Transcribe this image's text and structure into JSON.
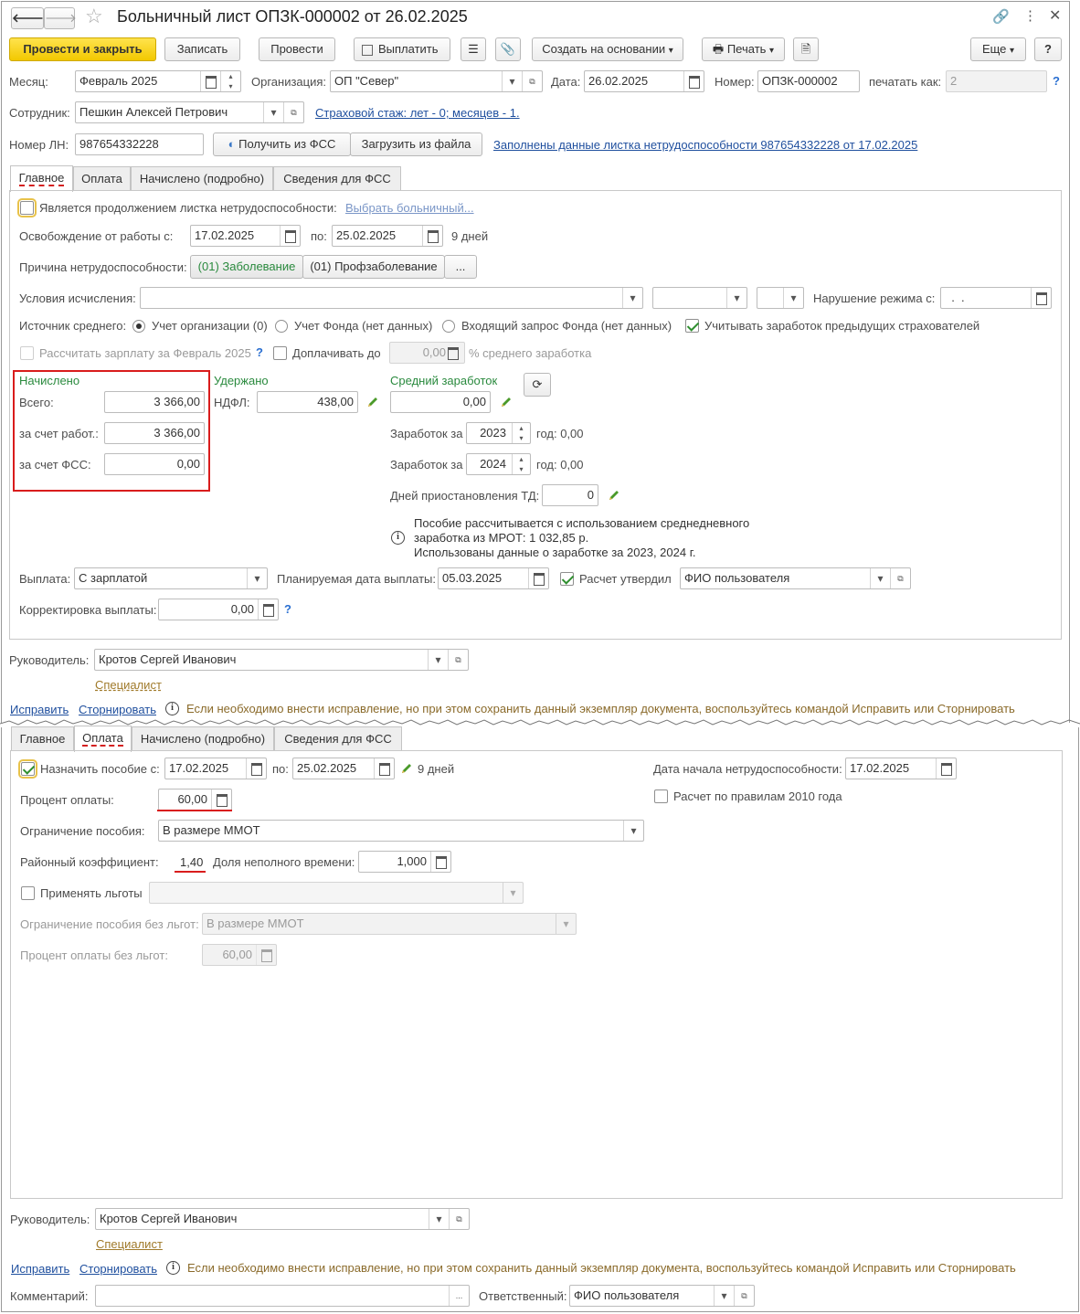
{
  "window": {
    "title": "Больничный лист ОПЗК-000002 от 26.02.2025"
  },
  "toolbar": {
    "post_close": "Провести и закрыть",
    "save": "Записать",
    "post": "Провести",
    "pay": "Выплатить",
    "create_based": "Создать на основании",
    "print": "Печать",
    "more": "Еще",
    "help": "?"
  },
  "header": {
    "month_label": "Месяц:",
    "month_value": "Февраль 2025",
    "org_label": "Организация:",
    "org_value": "ОП \"Север\"",
    "date_label": "Дата:",
    "date_value": "26.02.2025",
    "number_label": "Номер:",
    "number_value": "ОПЗК-000002",
    "print_as_label": "печатать как:",
    "print_as_value": "2",
    "employee_label": "Сотрудник:",
    "employee_value": "Пешкин Алексей Петрович",
    "insurance_link": "Страховой стаж: лет - 0; месяцев - 1.",
    "ln_label": "Номер ЛН:",
    "ln_value": "987654332228",
    "get_fss": "Получить из ФСС",
    "load_file": "Загрузить из файла",
    "filled_link": "Заполнены данные листка нетрудоспособности 987654332228 от 17.02.2025"
  },
  "tabs": [
    "Главное",
    "Оплата",
    "Начислено (подробно)",
    "Сведения для ФСС"
  ],
  "main": {
    "continuation": "Является продолжением листка нетрудоспособности:",
    "choose_link": "Выбрать больничный...",
    "release_label": "Освобождение от работы с:",
    "release_from": "17.02.2025",
    "to_label": "по:",
    "release_to": "25.02.2025",
    "days": "9 дней",
    "reason_label": "Причина нетрудоспособности:",
    "reason1": "(01) Заболевание",
    "reason2": "(01) Профзаболевание",
    "reason_more": "...",
    "conditions_label": "Условия исчисления:",
    "violation_label": "Нарушение режима с:",
    "violation_value": "  .  .",
    "source_label": "Источник среднего:",
    "src1": "Учет организации (0)",
    "src2": "Учет Фонда (нет данных)",
    "src3": "Входящий запрос Фонда (нет данных)",
    "prev_insurers": "Учитывать заработок предыдущих страхователей",
    "calc_salary": "Рассчитать зарплату за Февраль 2025",
    "extra_pay": "Доплачивать до",
    "extra_value": "0,00",
    "extra_suffix": "% среднего заработка",
    "accrued_title": "Начислено",
    "total_label": "Всего:",
    "total_value": "3 366,00",
    "employer_label": "за счет работ.:",
    "employer_value": "3 366,00",
    "fss_label": "за счет ФСС:",
    "fss_value": "0,00",
    "withheld_title": "Удержано",
    "ndfl_label": "НДФЛ:",
    "ndfl_value": "438,00",
    "avg_title": "Средний заработок",
    "avg_value": "0,00",
    "earn_label": "Заработок за",
    "year1": "2023",
    "year1_text": "год: 0,00",
    "year2": "2024",
    "year2_text": "год: 0,00",
    "suspend_label": "Дней приостановления ТД:",
    "suspend_value": "0",
    "note1": "Пособие рассчитывается с использованием среднедневного",
    "note2": "заработка из МРОТ: 1 032,85 р.",
    "note3": "Использованы данные о заработке за  2023,  2024 г.",
    "payment_label": "Выплата:",
    "payment_value": "С зарплатой",
    "planned_label": "Планируемая дата выплаты:",
    "planned_value": "05.03.2025",
    "approved_label": "Расчет утвердил",
    "approved_value": "ФИО пользователя",
    "correction_label": "Корректировка выплаты:",
    "correction_value": "0,00",
    "manager_label": "Руководитель:",
    "manager_value": "Кротов Сергей Иванович",
    "specialist": "Специалист",
    "fix": "Исправить",
    "storno": "Сторнировать",
    "fix_note": "Если необходимо внести исправление, но при этом сохранить данный экземпляр документа, воспользуйтесь командой Исправить или Сторнировать"
  },
  "payment": {
    "assign_label": "Назначить пособие с:",
    "assign_from": "17.02.2025",
    "to_label": "по:",
    "assign_to": "25.02.2025",
    "days": "9 дней",
    "start_label": "Дата начала нетрудоспособности:",
    "start_value": "17.02.2025",
    "rules2010": "Расчет по правилам 2010 года",
    "percent_label": "Процент оплаты:",
    "percent_value": "60,00",
    "limit_label": "Ограничение пособия:",
    "limit_value": "В размере ММОТ",
    "coef_label": "Районный коэффициент:",
    "coef_value": "1,40",
    "part_label": "Доля неполного времени:",
    "part_value": "1,000",
    "benefits_label": "Применять льготы",
    "limit_nb_label": "Ограничение пособия без льгот:",
    "limit_nb_value": "В размере ММОТ",
    "percent_nb_label": "Процент оплаты без льгот:",
    "percent_nb_value": "60,00",
    "manager_label": "Руководитель:",
    "manager_value": "Кротов Сергей Иванович",
    "specialist": "Специалист",
    "fix": "Исправить",
    "storno": "Сторнировать",
    "fix_note": "Если необходимо внести исправление, но при этом сохранить данный экземпляр документа, воспользуйтесь командой Исправить или Сторнировать",
    "comment_label": "Комментарий:",
    "comment_more": "...",
    "responsible_label": "Ответственный:",
    "responsible_value": "ФИО пользователя"
  }
}
